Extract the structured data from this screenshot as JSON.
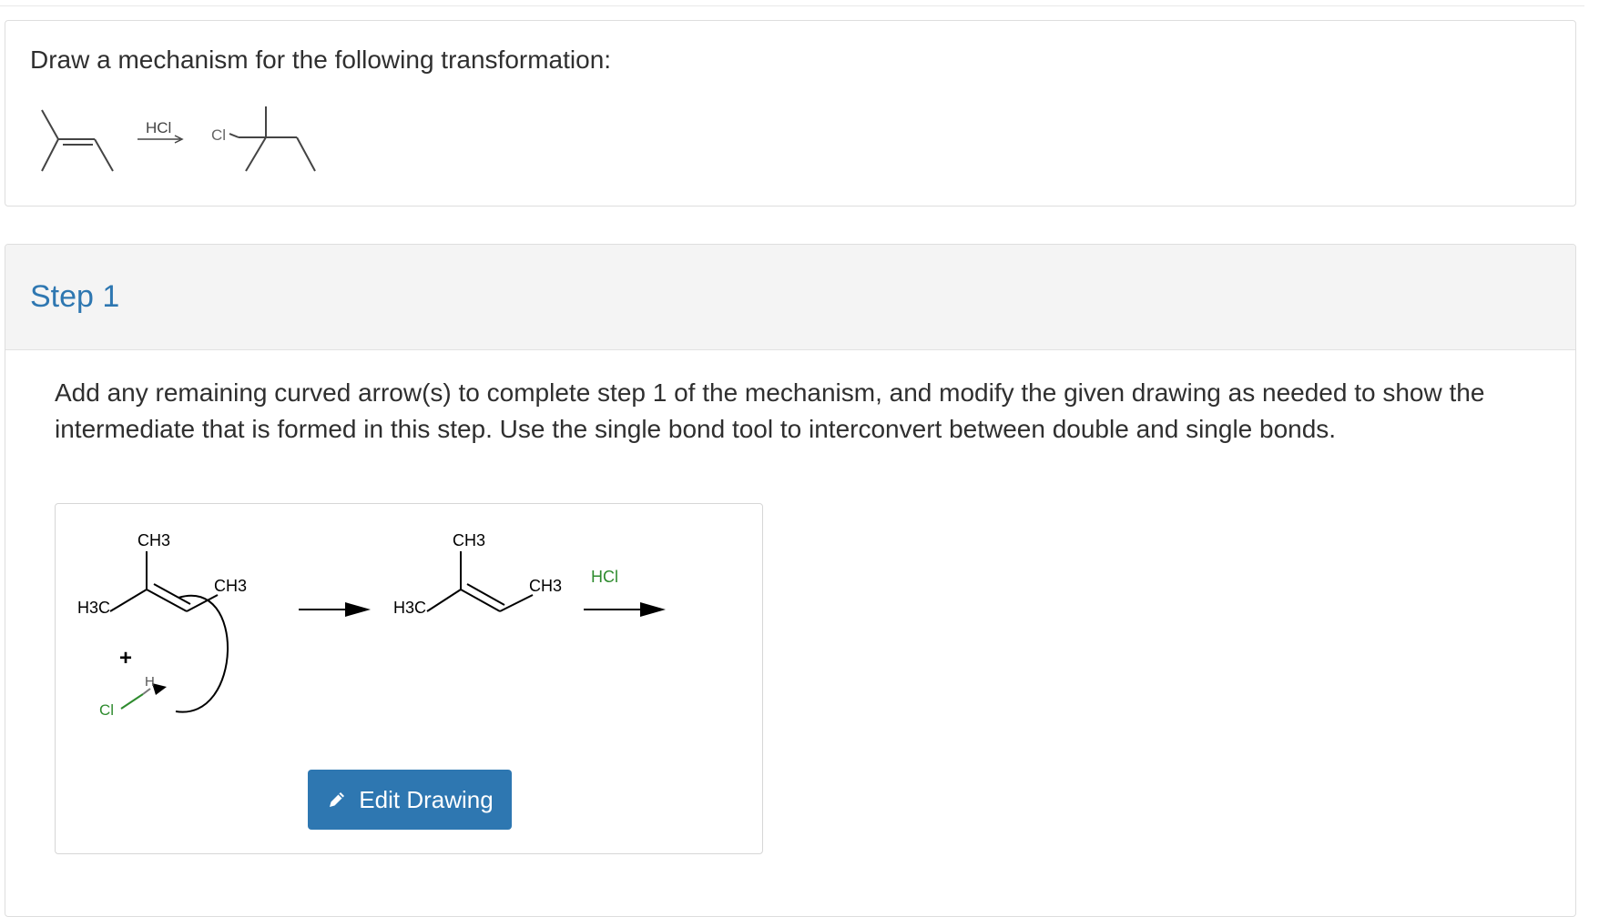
{
  "question": {
    "prompt": "Draw a mechanism for the following transformation:",
    "reaction": {
      "reagent": "HCl",
      "product_label": "Cl"
    }
  },
  "step": {
    "title": "Step 1",
    "instructions": "Add any remaining curved arrow(s) to complete step 1 of the mechanism, and modify the given drawing as needed to show the intermediate that is formed in this step. Use the single bond tool to interconvert between double and single bonds."
  },
  "drawing": {
    "reactant": {
      "top_methyl": "CH3",
      "right_methyl": "CH3",
      "left_methyl": "H3C",
      "plus_sign": "+",
      "hydrogen": "H",
      "chlorine": "Cl"
    },
    "intermediate": {
      "top_methyl": "CH3",
      "right_methyl": "CH3",
      "left_methyl": "H3C"
    },
    "reagent_label": "HCl",
    "reagent_color": "#2e8b2e",
    "edit_button_label": "Edit Drawing",
    "edit_button_icon": "pencil-icon"
  },
  "colors": {
    "accent": "#2e77b1",
    "chlorine": "#2e8b2e"
  }
}
